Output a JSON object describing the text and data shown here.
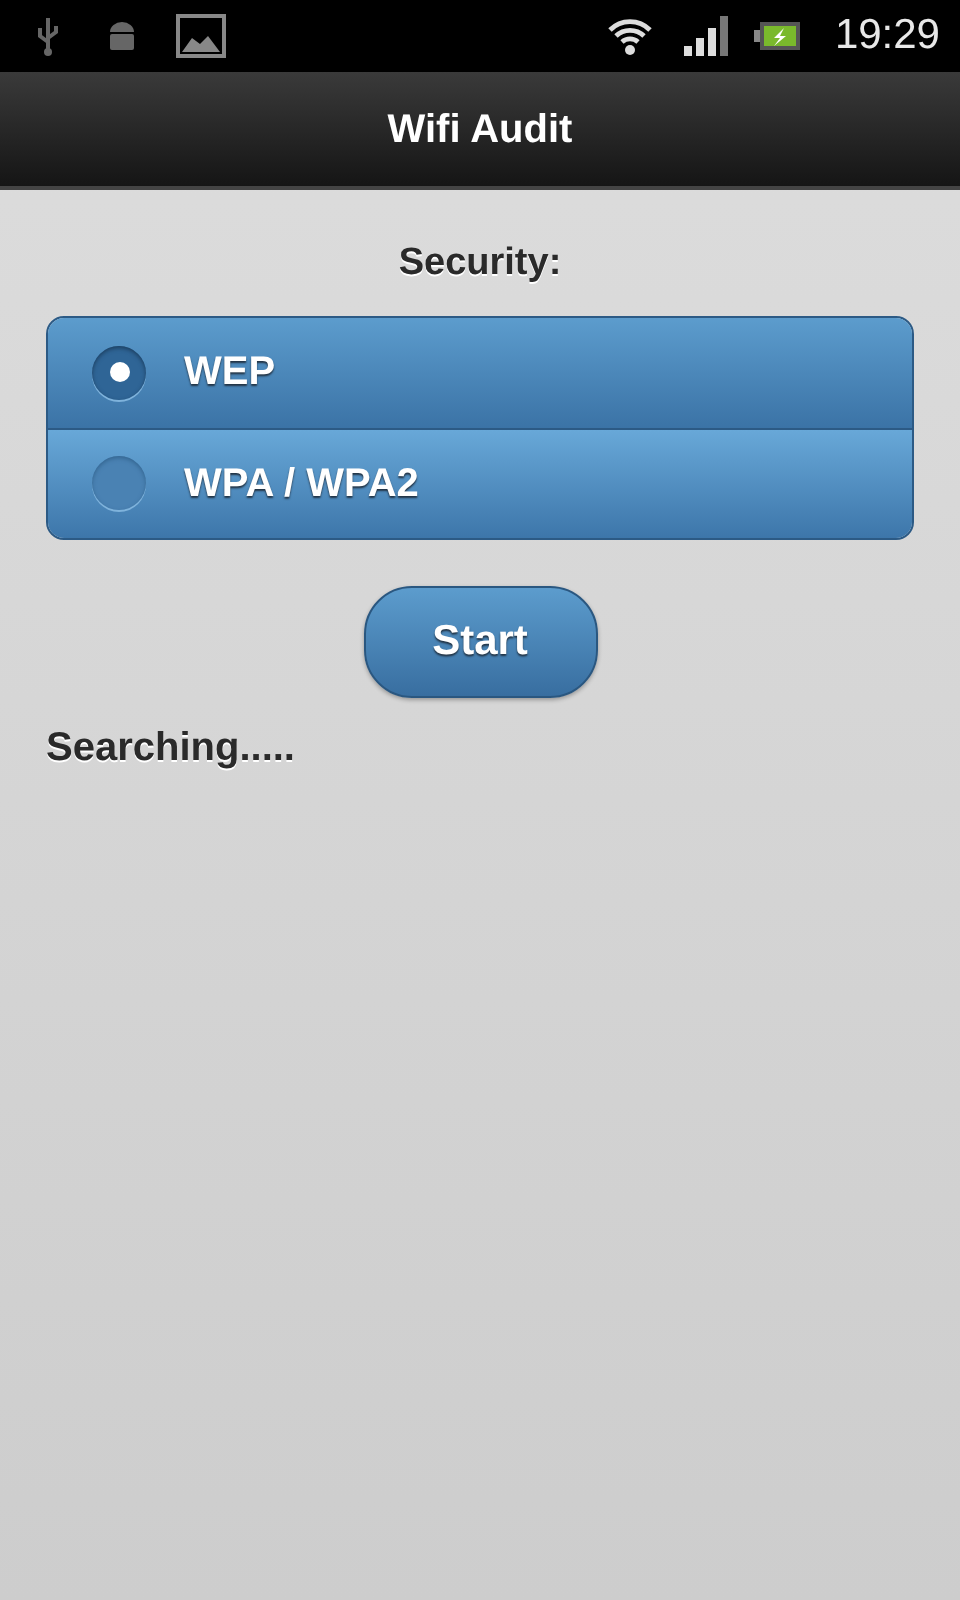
{
  "status_bar": {
    "time": "19:29"
  },
  "header": {
    "title": "Wifi Audit"
  },
  "security": {
    "label": "Security:",
    "options": [
      {
        "label": "WEP",
        "selected": true
      },
      {
        "label": "WPA / WPA2",
        "selected": false
      }
    ]
  },
  "start_button": {
    "label": "Start"
  },
  "status_text": "Searching....."
}
